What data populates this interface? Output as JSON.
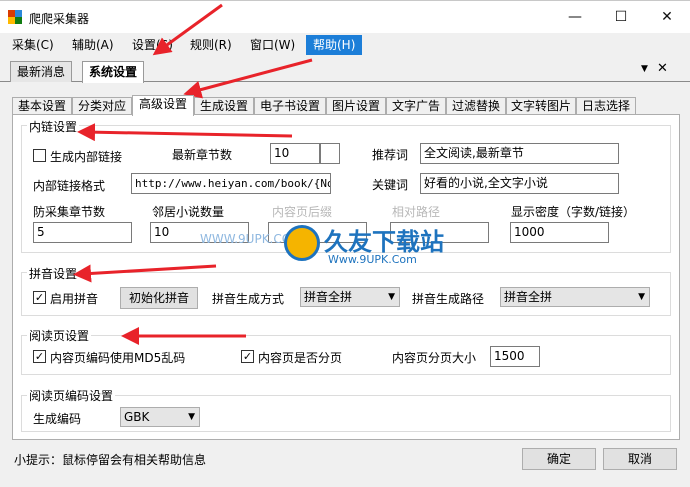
{
  "window": {
    "title": "爬爬采集器",
    "minimize_glyph": "—",
    "maximize_glyph": "☐",
    "close_glyph": "✕"
  },
  "menu": [
    "采集(C)",
    "辅助(A)",
    "设置(S)",
    "规则(R)",
    "窗口(W)",
    "帮助(H)"
  ],
  "doc_tabs": {
    "items": [
      "最新消息",
      "系统设置"
    ],
    "menu_glyph": "▼",
    "close_glyph": "✕"
  },
  "settings_tabs": [
    "基本设置",
    "分类对应",
    "高级设置",
    "生成设置",
    "电子书设置",
    "图片设置",
    "文字广告",
    "过滤替换",
    "文字转图片",
    "日志选择"
  ],
  "internal_link": {
    "legend": "内链设置",
    "generate_internal_link": {
      "label": "生成内部链接",
      "checked": false
    },
    "latest_chapters": {
      "label": "最新章节数",
      "value": "10"
    },
    "recommend": {
      "label": "推荐词",
      "value": "全文阅读,最新章节"
    },
    "link_format": {
      "label": "内部链接格式",
      "value": "http://www.heiyan.com/book/{Nove"
    },
    "keywords": {
      "label": "关键词",
      "value": "好看的小说,全文字小说"
    },
    "anti_chapters": {
      "label": "防采集章节数",
      "value": "5"
    },
    "neighbor_count": {
      "label": "邻居小说数量",
      "value": "10"
    },
    "page_suffix": {
      "label": "内容页后缀"
    },
    "relative_path": {
      "label": "相对路径"
    },
    "display_density": {
      "label": "显示密度（字数/链接）",
      "value": "1000"
    }
  },
  "pinyin": {
    "legend": "拼音设置",
    "enable": {
      "label": "启用拼音",
      "checked": true
    },
    "init_button": "初始化拼音",
    "gen_method": {
      "label": "拼音生成方式",
      "value": "拼音全拼"
    },
    "gen_path": {
      "label": "拼音生成路径",
      "value": "拼音全拼"
    }
  },
  "reading_page": {
    "legend": "阅读页设置",
    "md5_encoding": {
      "label": "内容页编码使用MD5乱码",
      "checked": true
    },
    "paginate": {
      "label": "内容页是否分页",
      "checked": true
    },
    "page_size": {
      "label": "内容页分页大小",
      "value": "1500"
    }
  },
  "reading_encoding": {
    "legend": "阅读页编码设置",
    "gen_encoding": {
      "label": "生成编码",
      "value": "GBK"
    }
  },
  "watermark": {
    "brand": "久友下载站",
    "url": "WWW.9UPK.COM",
    "url2": "Www.9UPK.Com"
  },
  "footer": {
    "tip": "小提示：鼠标停留会有相关帮助信息",
    "ok": "确定",
    "cancel": "取消"
  },
  "colors": {
    "accent": "#1c7ed8",
    "annotation_arrow": "#e8232a"
  }
}
